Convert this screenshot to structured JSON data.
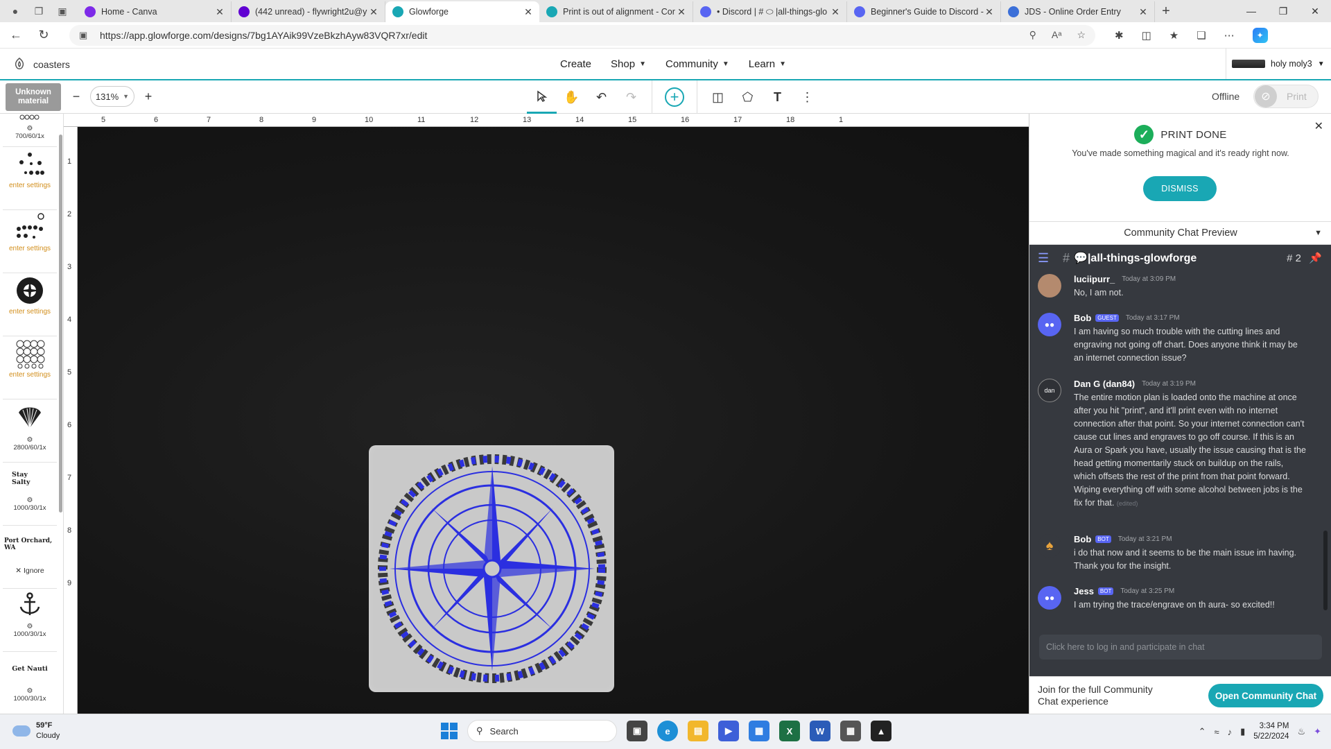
{
  "browser": {
    "tabs": [
      {
        "title": "Home - Canva",
        "icon": "canva-icon",
        "color": "#7d2ae8"
      },
      {
        "title": "(442 unread) - flywright2u@y",
        "icon": "mail-icon",
        "color": "#6001d2"
      },
      {
        "title": "Glowforge",
        "icon": "glowforge-icon",
        "color": "#19a7b4",
        "active": true
      },
      {
        "title": "Print is out of alignment - Cor",
        "icon": "glowforge-icon",
        "color": "#19a7b4"
      },
      {
        "title": "• Discord | # ⬭ |all-things-glo",
        "icon": "discord-icon",
        "color": "#5865f2"
      },
      {
        "title": "Beginner's Guide to Discord -",
        "icon": "discord-icon",
        "color": "#5865f2"
      },
      {
        "title": "JDS - Online Order Entry",
        "icon": "web-icon",
        "color": "#3b6fd8"
      }
    ],
    "url": "https://app.glowforge.com/designs/7bg1AYAik99VzeBkzhAyw83VQR7xr/edit"
  },
  "app": {
    "doc_name": "coasters",
    "nav": [
      "Create",
      "Shop",
      "Community",
      "Learn"
    ],
    "account_name": "holy moly3"
  },
  "toolbar": {
    "material_label": "Unknown material",
    "zoom_value": "131%",
    "offline_label": "Offline",
    "print_label": "Print"
  },
  "steps": [
    {
      "kind": "settings",
      "value": "700/60/1x"
    },
    {
      "kind": "enter",
      "label": "enter settings"
    },
    {
      "kind": "enter",
      "label": "enter settings"
    },
    {
      "kind": "enter",
      "label": "enter settings"
    },
    {
      "kind": "enter",
      "label": "enter settings"
    },
    {
      "kind": "settings",
      "value": "2800/60/1x"
    },
    {
      "kind": "text",
      "art": "Stay Salty",
      "value": "1000/30/1x"
    },
    {
      "kind": "ignore",
      "art": "Port Orchard, WA",
      "label": "Ignore"
    },
    {
      "kind": "settings",
      "value": "1000/30/1x"
    },
    {
      "kind": "text",
      "art": "Get Nauti",
      "value": "1000/30/1x"
    }
  ],
  "rulers": {
    "top": [
      "5",
      "6",
      "7",
      "8",
      "9",
      "10",
      "11",
      "12",
      "13",
      "14",
      "15",
      "16",
      "17",
      "18",
      "1"
    ],
    "left": [
      "1",
      "2",
      "3",
      "4",
      "5",
      "6",
      "7",
      "8",
      "9"
    ]
  },
  "print_done": {
    "title": "PRINT DONE",
    "message": "You've made something magical and it's ready right now.",
    "dismiss_label": "DISMISS"
  },
  "community": {
    "preview_label": "Community Chat Preview",
    "channel": "💬|all-things-glowforge",
    "thread_count": "2",
    "messages": [
      {
        "name": "luciipurr_",
        "tag": "",
        "time": "Today at 3:09 PM",
        "text": "No, I am not.",
        "avatar_color": "#b48a6e",
        "edited": ""
      },
      {
        "name": "Bob",
        "tag": "GUEST",
        "time": "Today at 3:17 PM",
        "text": "I am having so much trouble with the cutting lines and engraving not going off chart.  Does anyone think it may be an internet connection issue?",
        "avatar_color": "#5865f2",
        "edited": ""
      },
      {
        "name": "Dan G (dan84)",
        "tag": "",
        "time": "Today at 3:19 PM",
        "text": "The entire motion plan is loaded onto the machine at once after you hit \"print\", and it'll print even with no internet connection after that point. So your internet connection can't cause cut lines and engraves to go off course. If this is an Aura or Spark you have, usually the issue causing that is the head getting momentarily stuck on buildup on the rails, which offsets the rest of the print from that point forward. Wiping everything off with some alcohol between jobs is the fix for that.",
        "avatar_color": "#2f3136",
        "edited": "(edited)"
      },
      {
        "name": "Bob",
        "tag": "BOT",
        "time": "Today at 3:21 PM",
        "text": "i do that now and it seems to be the main issue im having.  Thank you for the insight.",
        "avatar_color": "#36393f",
        "edited": ""
      },
      {
        "name": "Jess",
        "tag": "BOT",
        "time": "Today at 3:25 PM",
        "text": "I am trying the trace/engrave on th aura- so excited!!",
        "avatar_color": "#5865f2",
        "edited": ""
      }
    ],
    "input_placeholder": "Click here to log in and participate in chat",
    "join_text": "Join for the full Community Chat experience",
    "open_label": "Open Community Chat"
  },
  "taskbar": {
    "temp": "59°F",
    "condition": "Cloudy",
    "search_label": "Search",
    "time": "3:34 PM",
    "date": "5/22/2024"
  }
}
